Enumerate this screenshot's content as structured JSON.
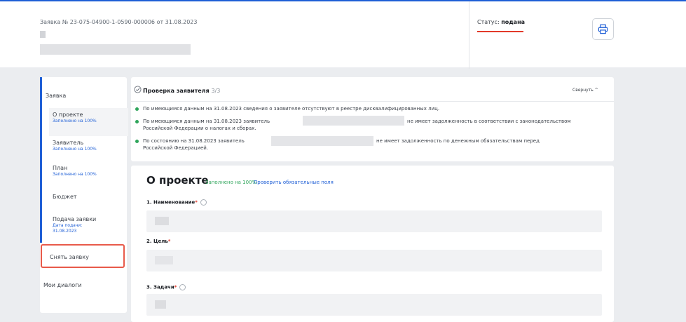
{
  "header": {
    "application_number": "Заявка № 23-075-04900-1-0590-000006 от 31.08.2023",
    "status_label": "Статус:",
    "status_value": "подана",
    "print_icon": "printer-icon"
  },
  "sidebar": {
    "group_label": "Заявка",
    "items": [
      {
        "label": "О проекте",
        "sub": "Заполнено на 100%"
      },
      {
        "label": "Заявитель",
        "sub": "Заполнено на 100%"
      },
      {
        "label": "План",
        "sub": "Заполнено на 100%"
      },
      {
        "label": "Бюджет",
        "sub": ""
      },
      {
        "label": "Подача заявки",
        "sub": "Дата подачи: 31.08.2023"
      }
    ],
    "withdraw_label": "Снять заявку",
    "dialogs_label": "Мои диалоги"
  },
  "check": {
    "title": "Проверка заявителя",
    "count": "3/3",
    "collapse_label": "Свернуть ^",
    "rows": [
      {
        "text": "По имеющимся данным на 31.08.2023 сведения о заявителе отсутствуют в реестре дисквалифицированных лиц."
      },
      {
        "text_before": "По имеющимся данным на 31.08.2023 заявитель",
        "text_after": "не имеет задолженность в соответствии с законодательством",
        "text_line2": "Российской Федерации о налогах и сборах."
      },
      {
        "text_before": "По состоянию на 31.08.2023 заявитель",
        "text_after": "не имеет задолженность по денежным обязательствам перед",
        "text_line2": "Российской Федерацией."
      }
    ]
  },
  "about": {
    "title": "О проекте",
    "filled": "Заполнено на 100%",
    "check_required": "Проверить обязательные поля",
    "fields": [
      {
        "label": "1. Наименование"
      },
      {
        "label": "2. Цель"
      },
      {
        "label": "3. Задачи"
      }
    ]
  },
  "colors": {
    "accent": "#1f5fd6",
    "success": "#2fa55b",
    "alert": "#e23a2a"
  }
}
